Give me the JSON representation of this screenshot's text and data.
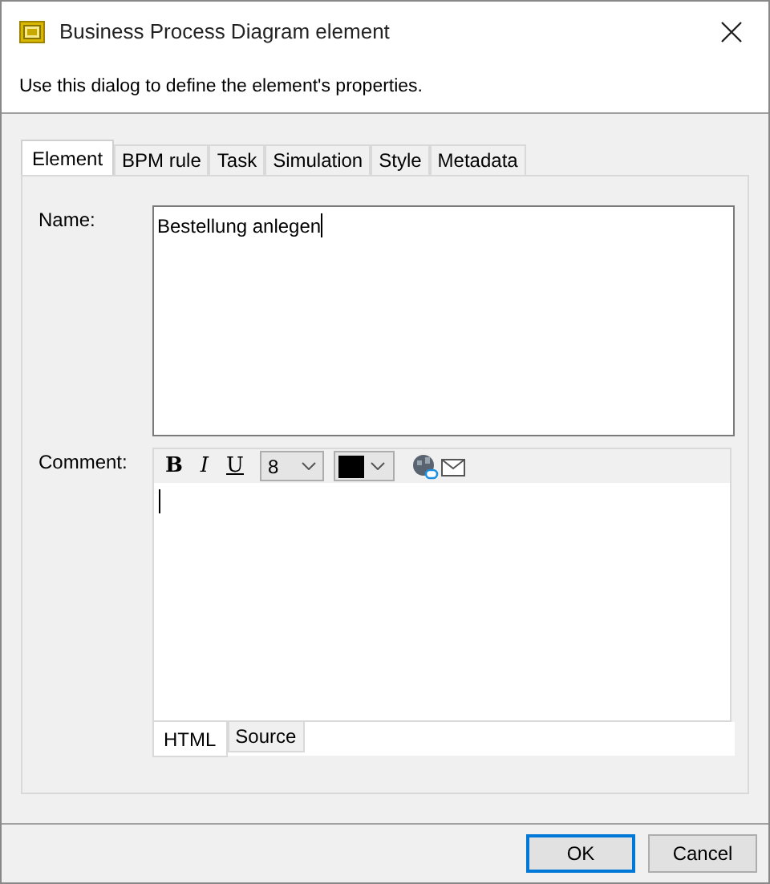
{
  "window": {
    "title": "Business Process Diagram element"
  },
  "description": "Use this dialog to define the element's properties.",
  "tabs": [
    {
      "label": "Element",
      "selected": true
    },
    {
      "label": "BPM rule",
      "selected": false
    },
    {
      "label": "Task",
      "selected": false
    },
    {
      "label": "Simulation",
      "selected": false
    },
    {
      "label": "Style",
      "selected": false
    },
    {
      "label": "Metadata",
      "selected": false
    }
  ],
  "name": {
    "label": "Name:",
    "value": "Bestellung anlegen"
  },
  "comment": {
    "label": "Comment:",
    "toolbar": {
      "bold": "B",
      "italic": "I",
      "underline": "U",
      "font_size": "8"
    },
    "editor_tabs": [
      {
        "label": "HTML",
        "selected": true
      },
      {
        "label": "Source",
        "selected": false
      }
    ]
  },
  "buttons": [
    {
      "label": "OK",
      "default": true
    },
    {
      "label": "Cancel",
      "default": false
    }
  ]
}
